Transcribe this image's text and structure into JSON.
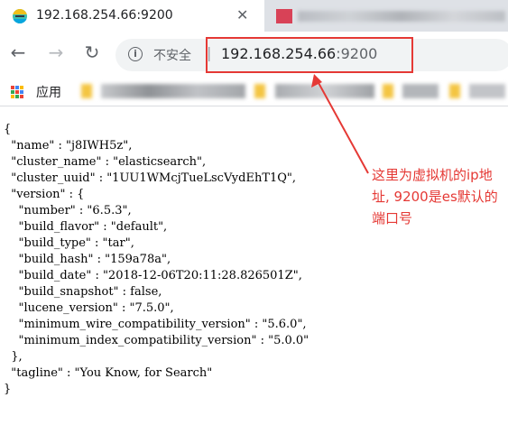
{
  "tab": {
    "title": "192.168.254.66:9200",
    "close": "✕"
  },
  "toolbar": {
    "security_label": "不安全",
    "separator": "|",
    "url_host": "192.168.254.66",
    "url_port": ":9200"
  },
  "bookmarks": {
    "apps_label": "应用"
  },
  "json_lines": [
    "{",
    "  \"name\" : \"j8IWH5z\",",
    "  \"cluster_name\" : \"elasticsearch\",",
    "  \"cluster_uuid\" : \"1UU1WMcjTueLscVydEhT1Q\",",
    "  \"version\" : {",
    "    \"number\" : \"6.5.3\",",
    "    \"build_flavor\" : \"default\",",
    "    \"build_type\" : \"tar\",",
    "    \"build_hash\" : \"159a78a\",",
    "    \"build_date\" : \"2018-12-06T20:11:28.826501Z\",",
    "    \"build_snapshot\" : false,",
    "    \"lucene_version\" : \"7.5.0\",",
    "    \"minimum_wire_compatibility_version\" : \"5.6.0\",",
    "    \"minimum_index_compatibility_version\" : \"5.0.0\"",
    "  },",
    "  \"tagline\" : \"You Know, for Search\"",
    "}"
  ],
  "annotation": {
    "text": "这里为虚拟机的ip地址, 9200是es默认的端口号"
  },
  "colors": {
    "annotation": "#e53935",
    "omnibox": "#f1f3f4"
  }
}
